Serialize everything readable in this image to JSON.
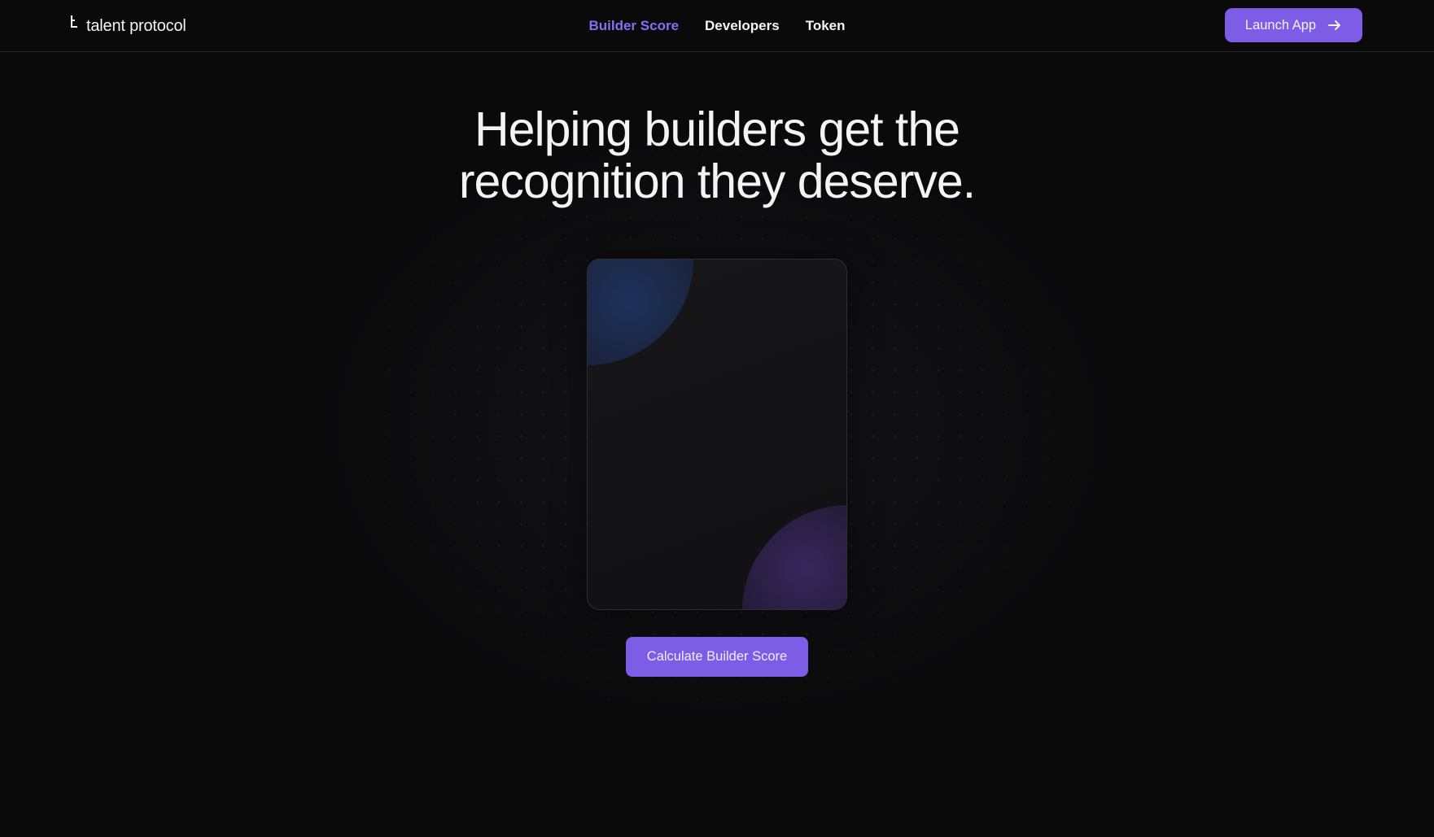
{
  "brand": {
    "name": "talent protocol",
    "icon": "talent-protocol-logo-icon"
  },
  "nav": {
    "items": [
      {
        "label": "Builder Score",
        "active": true
      },
      {
        "label": "Developers",
        "active": false
      },
      {
        "label": "Token",
        "active": false
      }
    ]
  },
  "header": {
    "launch_label": "Launch App",
    "launch_icon": "arrow-right-icon"
  },
  "hero": {
    "title_line1": "Helping builders get the",
    "title_line2": "recognition they deserve.",
    "cta_label": "Calculate Builder Score"
  },
  "colors": {
    "background": "#0a0a0b",
    "accent": "#7d5ce6",
    "active_nav": "#8b6cf2",
    "text": "#f4f4f5"
  }
}
